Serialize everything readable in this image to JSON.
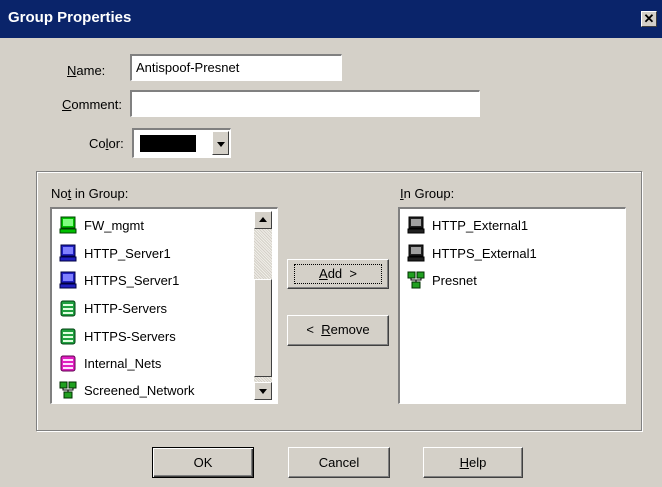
{
  "window": {
    "title": "Group Properties",
    "close_glyph": "✕"
  },
  "form": {
    "name_label_u": "N",
    "name_label_rest": "ame:",
    "name_value": "Antispoof-Presnet",
    "comment_label_u": "C",
    "comment_label_rest": "omment:",
    "comment_value": "",
    "color_label_pre": "Co",
    "color_label_u": "l",
    "color_label_post": "or:",
    "color_value": "#000000"
  },
  "not_in_group": {
    "label_pre": "No",
    "label_u": "t",
    "label_post": " in Group:",
    "items": [
      {
        "label": "FW_mgmt",
        "icon": "workstation-green-icon"
      },
      {
        "label": "HTTP_Server1",
        "icon": "workstation-blue-icon"
      },
      {
        "label": "HTTPS_Server1",
        "icon": "workstation-blue-icon"
      },
      {
        "label": "HTTP-Servers",
        "icon": "group-green-icon"
      },
      {
        "label": "HTTPS-Servers",
        "icon": "group-green-icon"
      },
      {
        "label": "Internal_Nets",
        "icon": "group-magenta-icon"
      },
      {
        "label": "Screened_Network",
        "icon": "network-icon"
      }
    ]
  },
  "in_group": {
    "label_u": "I",
    "label_rest": "n Group:",
    "items": [
      {
        "label": "HTTP_External1",
        "icon": "workstation-black-icon"
      },
      {
        "label": "HTTPS_External1",
        "icon": "workstation-black-icon"
      },
      {
        "label": "Presnet",
        "icon": "network-icon"
      }
    ]
  },
  "buttons": {
    "add_u": "A",
    "add_rest": "dd  >",
    "remove_pre": "<  ",
    "remove_u": "R",
    "remove_rest": "emove",
    "ok": "OK",
    "cancel": "Cancel",
    "help_u": "H",
    "help_rest": "elp"
  }
}
